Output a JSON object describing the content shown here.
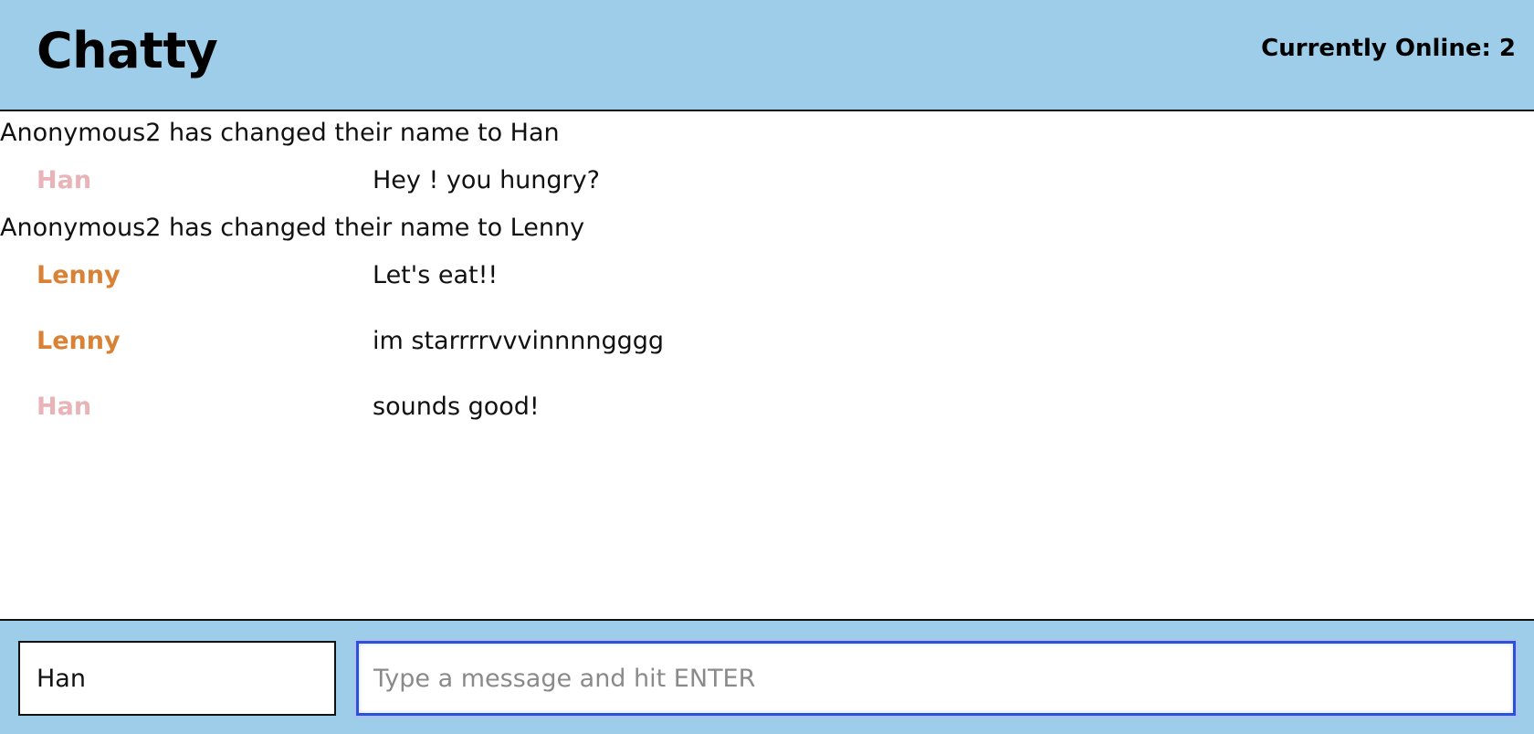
{
  "header": {
    "brand": "Chatty",
    "online_label": "Currently Online: 2"
  },
  "messages": {
    "system": [
      "Anonymous2 has changed their name to Han",
      "Anonymous2 has changed their name to Lenny"
    ],
    "chat": [
      {
        "user": "Han",
        "text": "Hey ! you hungry?"
      },
      {
        "user": "Lenny",
        "text": "Let's eat!!"
      },
      {
        "user": "Lenny",
        "text": "im starrrrvvvinnnngggg"
      },
      {
        "user": "Han",
        "text": "sounds good!"
      }
    ]
  },
  "colors": {
    "header_bg": "#9ecdea",
    "han_color": "#e8b4b8",
    "lenny_color": "#d98236",
    "focus_border": "#2b52d6"
  },
  "footer": {
    "name_value": "Han",
    "message_placeholder": "Type a message and hit ENTER"
  }
}
